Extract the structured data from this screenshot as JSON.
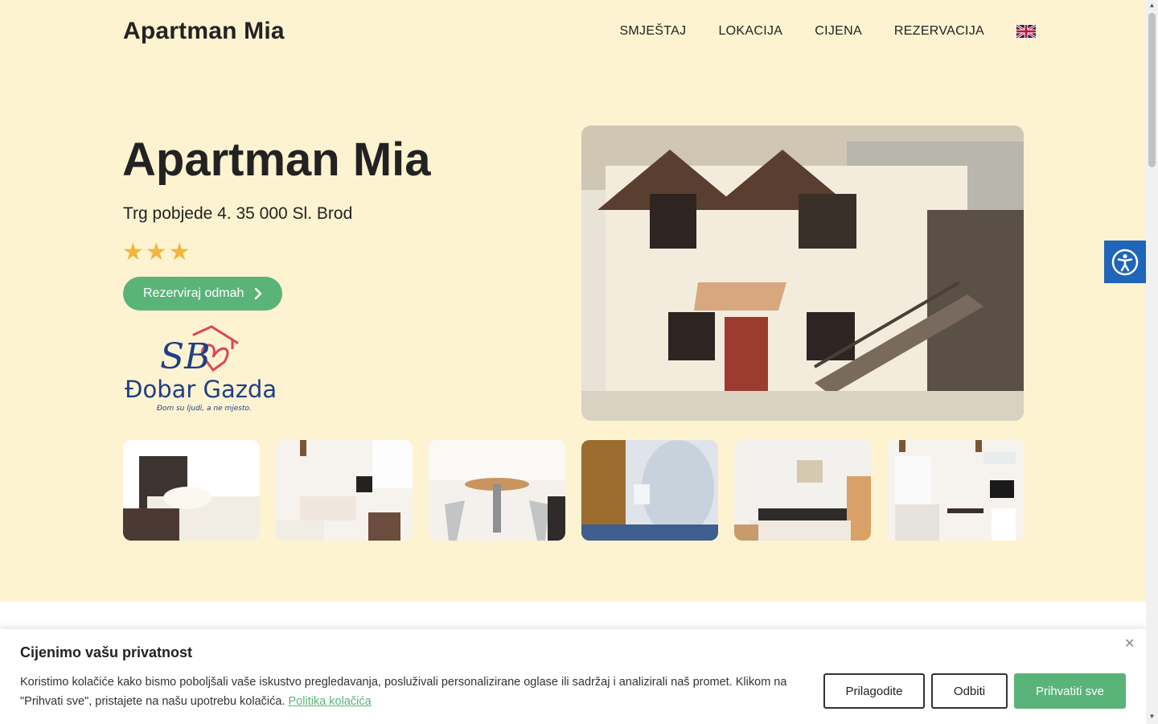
{
  "header": {
    "brand": "Apartman Mia",
    "nav": [
      "SMJEŠTAJ",
      "LOKACIJA",
      "CIJENA",
      "REZERVACIJA"
    ],
    "language_flag_icon": "uk-flag-icon"
  },
  "hero": {
    "title": "Apartman Mia",
    "address": "Trg pobjede 4. 35 000 Sl. Brod",
    "stars": "★★★",
    "rating_stars": 3,
    "cta_label": "Rezerviraj odmah",
    "logo": {
      "monogram": "SB",
      "name": "Đobar Gazda",
      "tagline": "Đom su ljudi, a ne mjesto."
    }
  },
  "gallery": {
    "thumbnails": [
      "bedroom-photo",
      "studio-room-photo",
      "dining-table-photo",
      "bathroom-photo",
      "double-bed-photo",
      "kitchen-photo"
    ]
  },
  "cookie_banner": {
    "title": "Cijenimo vašu privatnost",
    "text": "Koristimo kolačiće kako bismo poboljšali vaše iskustvo pregledavanja, posluživali personalizirane oglase ili sadržaj i analizirali naš promet. Klikom na \"Prihvati sve\", pristajete na našu upotrebu kolačića.",
    "link": "Politika kolačića",
    "close": "✕",
    "buttons": {
      "customize": "Prilagodite",
      "reject": "Odbiti",
      "accept": "Prihvatiti sve"
    }
  },
  "colors": {
    "hero_bg": "#fdf3d1",
    "accent_green": "#5ab47a",
    "star_gold": "#f0b73e",
    "accessibility_blue": "#1f65b9"
  }
}
